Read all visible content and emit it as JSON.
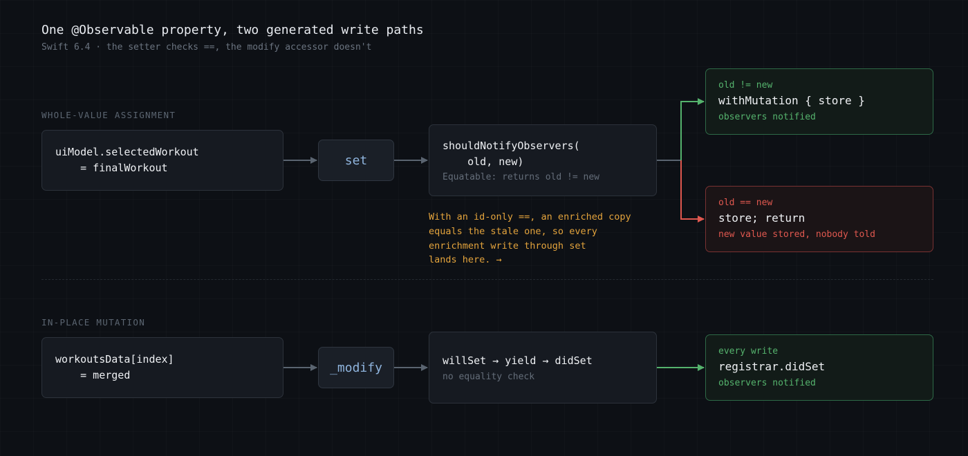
{
  "header": {
    "title": "One @Observable property, two generated write paths",
    "subtitle": "Swift 6.4 · the setter checks ==, the modify accessor doesn't"
  },
  "whole_value": {
    "label": "WHOLE-VALUE ASSIGNMENT",
    "source_code": "uiModel.selectedWorkout\n    = finalWorkout",
    "accessor": "set",
    "check_code": "shouldNotifyObservers(\n    old, new)",
    "check_note": "Equatable: returns old != new",
    "annotation": "With an id-only ==, an enriched copy\nequals the stale one, so every\nenrichment write through set\nlands here. →",
    "outcome_notify": {
      "condition": "old != new",
      "code": "withMutation { store }",
      "note": "observers notified"
    },
    "outcome_silent": {
      "condition": "old == new",
      "code": "store; return",
      "note": "new value stored, nobody told"
    }
  },
  "in_place": {
    "label": "IN-PLACE MUTATION",
    "source_code": "workoutsData[index]\n    = merged",
    "accessor": "_modify",
    "check_code": "willSet → yield → didSet",
    "check_note": "no equality check",
    "outcome": {
      "condition": "every write",
      "code": "registrar.didSet",
      "note": "observers notified"
    }
  },
  "colors": {
    "background": "#0d1015",
    "notify_green": "#55b36d",
    "silent_red": "#e0584f",
    "annotation_amber": "#e3a33c",
    "accessor_blue": "#8fb4dd",
    "connector_gray": "#5a6470"
  }
}
